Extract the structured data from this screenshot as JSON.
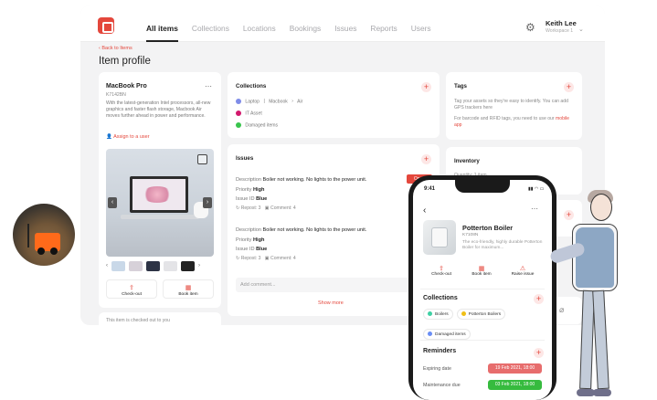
{
  "nav": {
    "items": [
      "All items",
      "Collections",
      "Locations",
      "Bookings",
      "Issues",
      "Reports",
      "Users"
    ],
    "active": "All items"
  },
  "user": {
    "name": "Keith Lee",
    "workspace": "Workspace 1"
  },
  "breadcrumb": {
    "back": "Back to Items"
  },
  "page": {
    "title": "Item profile"
  },
  "item": {
    "name": "MacBook Pro",
    "id": "K7142BN",
    "description": "With the latest-generation Intel processors, all-new graphics and faster flash storage, Macbook Air moves further ahead in power and performance.",
    "assign": "Assign to a user",
    "checkout_label": "Check-out",
    "book_label": "Book item",
    "status_footer": "This item is checked out to you"
  },
  "collections": {
    "title": "Collections",
    "rows": [
      {
        "color": "#7f8ce8",
        "path": [
          "Laptop",
          "Macbook",
          "Air"
        ]
      },
      {
        "color": "#d2196d",
        "path": [
          "IT Asset"
        ]
      },
      {
        "color": "#39c44d",
        "path": [
          "Damaged items"
        ]
      }
    ]
  },
  "issues": {
    "title": "Issues",
    "list": [
      {
        "description_label": "Description",
        "description_value": "Boiler not working. No lights to the power unit.",
        "priority_label": "Priority",
        "priority_value": "High",
        "issue_id_label": "Issue ID",
        "issue_id_value": "Blue",
        "repost": "Repost: 3",
        "comment": "Comment: 4",
        "status": "Open"
      },
      {
        "description_label": "Description",
        "description_value": "Boiler not working. No lights to the power unit.",
        "priority_label": "Priority",
        "priority_value": "High",
        "issue_id_label": "Issue ID",
        "issue_id_value": "Blue",
        "repost": "Repost: 3",
        "comment": "Comment: 4"
      }
    ],
    "comment_placeholder": "Add comment...",
    "show_more": "Show more"
  },
  "tags": {
    "title": "Tags",
    "text1": "Tag your assets so they're easy to identify. You can add GPS trackers here",
    "text2": "For barcode and RFID tags, you need to use our",
    "link": "mobile app"
  },
  "inventory": {
    "title": "Inventory",
    "quantity": "Quantity: 1 item"
  },
  "mobile": {
    "time": "9:41",
    "item_name": "Potterton Boiler",
    "item_id": "K7108N",
    "item_desc": "The eco-friendly, highly durable Potterton Boiler for maximum...",
    "actions": [
      "Check-out",
      "Book item",
      "Raise issue"
    ],
    "collections_title": "Collections",
    "collections": [
      {
        "label": "Boilers",
        "color": "#3fd0a4"
      },
      {
        "label": "Potterton Boilers",
        "color": "#f0bf16"
      },
      {
        "label": "Damaged items",
        "color": "#6a8ef5"
      }
    ],
    "reminders_title": "Reminders",
    "reminders": [
      {
        "label": "Expiring date",
        "value": "19 Feb 2021, 18:00",
        "color": "#e76d6d"
      },
      {
        "label": "Maintenance due",
        "value": "03 Feb 2021, 18:00",
        "color": "#36bb3e"
      }
    ]
  },
  "icons": [
    "gear-icon",
    "chevron-down-icon",
    "plus-icon",
    "expand-icon",
    "checkout-icon",
    "calendar-icon",
    "warning-icon",
    "chat-icon",
    "repost-icon",
    "paperclip-icon"
  ]
}
